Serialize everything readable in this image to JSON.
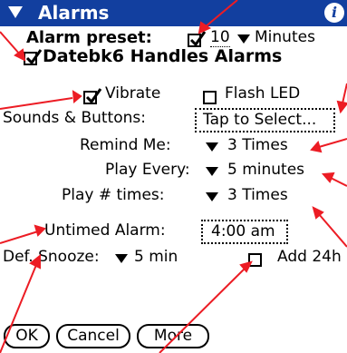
{
  "title": "Alarms",
  "info_glyph": "i",
  "alarm_preset": {
    "label": "Alarm preset:",
    "checked": true,
    "value": "10",
    "unit": "Minutes"
  },
  "handles_alarms": {
    "label": "Datebk6 Handles Alarms",
    "checked": true
  },
  "vibrate": {
    "label": "Vibrate",
    "checked": true
  },
  "flash_led": {
    "label": "Flash LED",
    "checked": false
  },
  "sounds_buttons": {
    "label": "Sounds & Buttons:",
    "value": "Tap to Select..."
  },
  "remind_me": {
    "label": "Remind Me:",
    "value": "3 Times"
  },
  "play_every": {
    "label": "Play Every:",
    "value": "5 minutes"
  },
  "play_times": {
    "label": "Play # times:",
    "value": "3 Times"
  },
  "untimed_alarm": {
    "label": "Untimed Alarm:",
    "value": "4:00 am"
  },
  "def_snooze": {
    "label": "Def. Snooze:",
    "value": "5 min"
  },
  "add_24h": {
    "label": "Add 24h",
    "checked": false
  },
  "buttons": {
    "ok": "OK",
    "cancel": "Cancel",
    "more": "More"
  },
  "colors": {
    "titlebar": "#123f9f",
    "annotation": "#ec1c24"
  }
}
